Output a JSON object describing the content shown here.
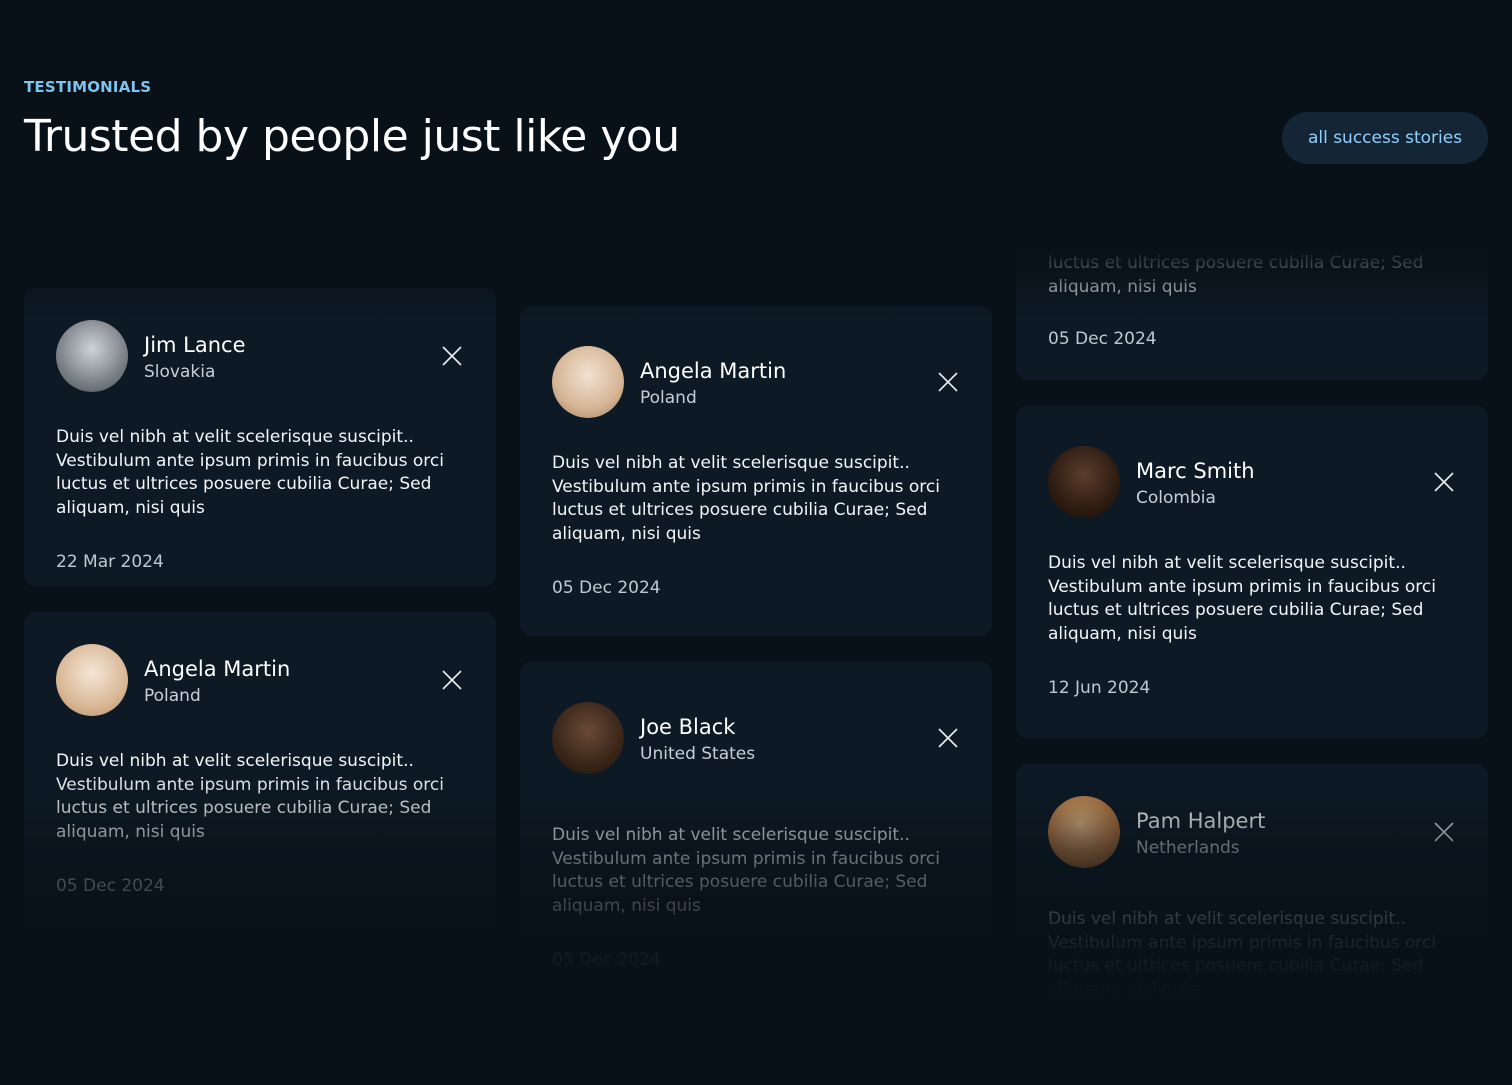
{
  "header": {
    "eyebrow": "TESTIMONIALS",
    "title": "Trusted by people just like you",
    "cta_label": "all success stories"
  },
  "colors": {
    "background": "#081018",
    "card": "#0d1a25",
    "accent": "#7fc3ef",
    "button_bg": "#142635"
  },
  "columns": [
    {
      "cards": [
        {
          "name": "Jim Lance",
          "country": "Slovakia",
          "quote": "Duis vel nibh at velit scelerisque suscipit.. Vestibulum ante ipsum primis in faucibus orci luctus et ultrices posuere cubilia Curae; Sed aliquam, nisi quis",
          "date": "22 Mar 2024",
          "icon": "x-logo-icon"
        },
        {
          "name": "Angela Martin",
          "country": "Poland",
          "quote": "Duis vel nibh at velit scelerisque suscipit.. Vestibulum ante ipsum primis in faucibus orci luctus et ultrices posuere cubilia Curae; Sed aliquam, nisi quis",
          "date": "05 Dec 2024",
          "icon": "x-logo-icon"
        }
      ]
    },
    {
      "cards": [
        {
          "name": "Angela Martin",
          "country": "Poland",
          "quote": "Duis vel nibh at velit scelerisque suscipit.. Vestibulum ante ipsum primis in faucibus orci luctus et ultrices posuere cubilia Curae; Sed aliquam, nisi quis",
          "date": "05 Dec 2024",
          "icon": "x-logo-icon"
        },
        {
          "name": "Joe Black",
          "country": "United States",
          "quote": "Duis vel nibh at velit scelerisque suscipit.. Vestibulum ante ipsum primis in faucibus orci luctus et ultrices posuere cubilia Curae; Sed aliquam, nisi quis",
          "date": "05 Dec 2024",
          "icon": "x-logo-icon"
        }
      ]
    },
    {
      "cards": [
        {
          "name": "",
          "country": "",
          "quote": "luctus et ultrices posuere cubilia Curae; Sed aliquam, nisi quis",
          "date": "05 Dec 2024",
          "icon": ""
        },
        {
          "name": "Marc Smith",
          "country": "Colombia",
          "quote": "Duis vel nibh at velit scelerisque suscipit.. Vestibulum ante ipsum primis in faucibus orci luctus et ultrices posuere cubilia Curae; Sed aliquam, nisi quis",
          "date": "12 Jun 2024",
          "icon": "x-logo-icon"
        },
        {
          "name": "Pam Halpert",
          "country": "Netherlands",
          "quote": "Duis vel nibh at velit scelerisque suscipit.. Vestibulum ante ipsum primis in faucibus orci luctus et ultrices posuere cubilia Curae; Sed aliquam, nisi quis",
          "date": "",
          "icon": "x-logo-icon"
        }
      ]
    }
  ]
}
